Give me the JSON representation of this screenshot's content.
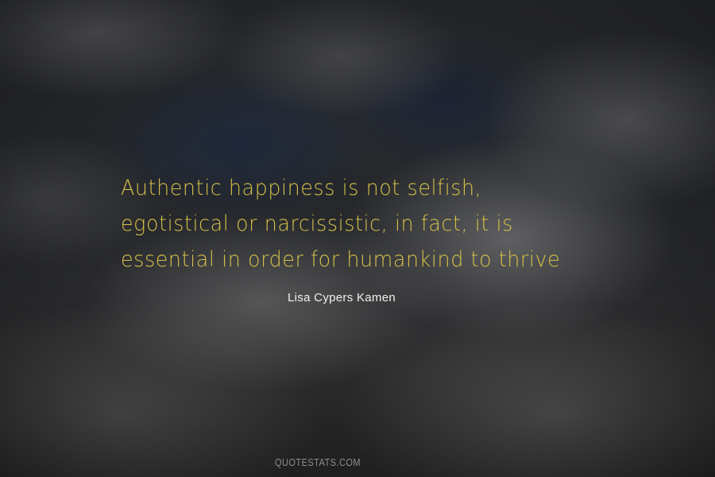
{
  "quote": {
    "lines": [
      "Authentic happiness is not selfish,",
      "egotistical or narcissistic, in fact, it is",
      "essential in order for humankind to thrive"
    ],
    "color": "#d4c04a"
  },
  "author": {
    "name": "Lisa Cypers Kamen",
    "color": "#f0f0f0"
  },
  "watermark": {
    "text": "QUOTESTATS.COM"
  },
  "background": {
    "description_color": "#2a2c31"
  }
}
